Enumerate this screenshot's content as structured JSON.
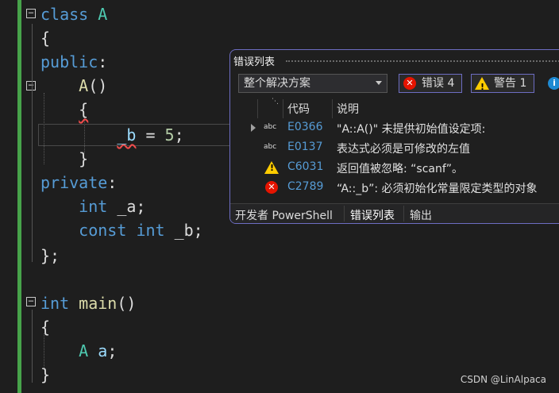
{
  "code": {
    "lines": [
      {
        "tokens": [
          {
            "t": "class ",
            "c": "kw"
          },
          {
            "t": "A",
            "c": "cls"
          }
        ]
      },
      {
        "tokens": [
          {
            "t": "{",
            "c": "pl"
          }
        ]
      },
      {
        "tokens": [
          {
            "t": "public",
            "c": "kw"
          },
          {
            "t": ":",
            "c": "pl"
          }
        ]
      },
      {
        "tokens": [
          {
            "t": "    ",
            "c": "pl"
          },
          {
            "t": "A",
            "c": "fn"
          },
          {
            "t": "()",
            "c": "pl"
          }
        ]
      },
      {
        "tokens": [
          {
            "t": "    ",
            "c": "pl"
          },
          {
            "t": "{",
            "c": "pl"
          }
        ]
      },
      {
        "tokens": [
          {
            "t": "        ",
            "c": "pl"
          },
          {
            "t": "_b",
            "c": "var"
          },
          {
            "t": " = ",
            "c": "pl"
          },
          {
            "t": "5",
            "c": "num"
          },
          {
            "t": ";",
            "c": "pl"
          }
        ]
      },
      {
        "tokens": [
          {
            "t": "    ",
            "c": "pl"
          },
          {
            "t": "}",
            "c": "pl"
          }
        ]
      },
      {
        "tokens": [
          {
            "t": "private",
            "c": "kw"
          },
          {
            "t": ":",
            "c": "pl"
          }
        ]
      },
      {
        "tokens": [
          {
            "t": "    ",
            "c": "pl"
          },
          {
            "t": "int",
            "c": "kw"
          },
          {
            "t": " _a;",
            "c": "pl"
          }
        ]
      },
      {
        "tokens": [
          {
            "t": "    ",
            "c": "pl"
          },
          {
            "t": "const",
            "c": "kw"
          },
          {
            "t": " ",
            "c": "pl"
          },
          {
            "t": "int",
            "c": "kw"
          },
          {
            "t": " _b;",
            "c": "pl"
          }
        ]
      },
      {
        "tokens": [
          {
            "t": "};",
            "c": "pl"
          }
        ]
      },
      {
        "tokens": []
      },
      {
        "tokens": [
          {
            "t": "int",
            "c": "kw"
          },
          {
            "t": " ",
            "c": "pl"
          },
          {
            "t": "main",
            "c": "fn"
          },
          {
            "t": "()",
            "c": "pl"
          }
        ]
      },
      {
        "tokens": [
          {
            "t": "{",
            "c": "pl"
          }
        ]
      },
      {
        "tokens": [
          {
            "t": "    ",
            "c": "pl"
          },
          {
            "t": "A",
            "c": "cls"
          },
          {
            "t": " ",
            "c": "pl"
          },
          {
            "t": "a",
            "c": "var"
          },
          {
            "t": ";",
            "c": "pl"
          }
        ]
      },
      {
        "tokens": [
          {
            "t": "}",
            "c": "pl"
          }
        ]
      }
    ]
  },
  "error_list": {
    "title": "错误列表",
    "scope": "整个解决方案",
    "errors_label": "错误 4",
    "warnings_label": "警告 1",
    "col_code": "代码",
    "col_desc": "说明",
    "rows": [
      {
        "kind": "abc",
        "code": "E0366",
        "desc": "\"A::A()\" 未提供初始值设定项:"
      },
      {
        "kind": "abc",
        "code": "E0137",
        "desc": "表达式必须是可修改的左值"
      },
      {
        "kind": "warning",
        "code": "C6031",
        "desc": "返回值被忽略: “scanf”。"
      },
      {
        "kind": "error",
        "code": "C2789",
        "desc": "“A::_b”: 必须初始化常量限定类型的对象"
      }
    ],
    "tabs": [
      "开发者 PowerShell",
      "错误列表",
      "输出"
    ]
  },
  "watermark": "CSDN @LinAlpaca"
}
